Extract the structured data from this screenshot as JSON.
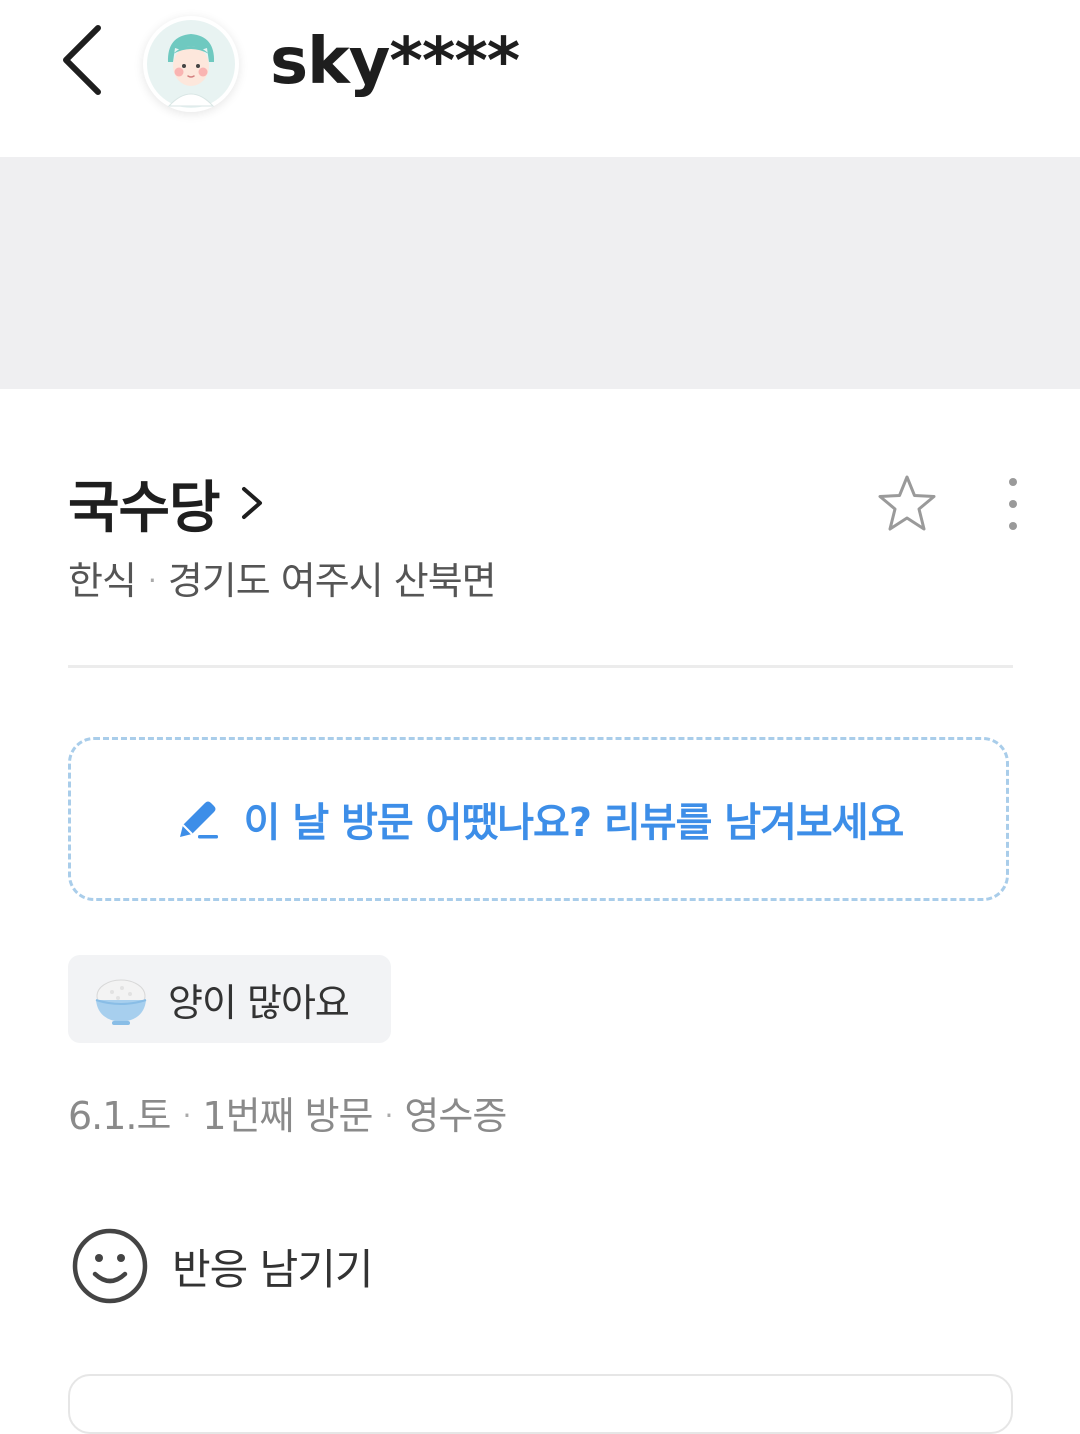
{
  "header": {
    "username": "sky****",
    "back_icon": "chevron-left-icon",
    "avatar_icon": "user-avatar-illustration"
  },
  "place": {
    "name": "국수당",
    "category": "한식",
    "address": "경기도 여주시 산북면",
    "separator": "·",
    "star_icon": "star-outline-icon",
    "more_icon": "more-vertical-icon"
  },
  "review_prompt": {
    "label": "이 날 방문 어땠나요? 리뷰를 남겨보세요",
    "icon": "pencil-icon",
    "accent_color": "#3d8ee8"
  },
  "keyword_chip": {
    "label": "양이 많아요",
    "icon": "rice-bowl-icon"
  },
  "visit": {
    "date": "6.1.토",
    "count": "1번째 방문",
    "verification": "영수증",
    "separator": "·"
  },
  "reaction": {
    "label": "반응 남기기",
    "icon": "smile-icon"
  }
}
